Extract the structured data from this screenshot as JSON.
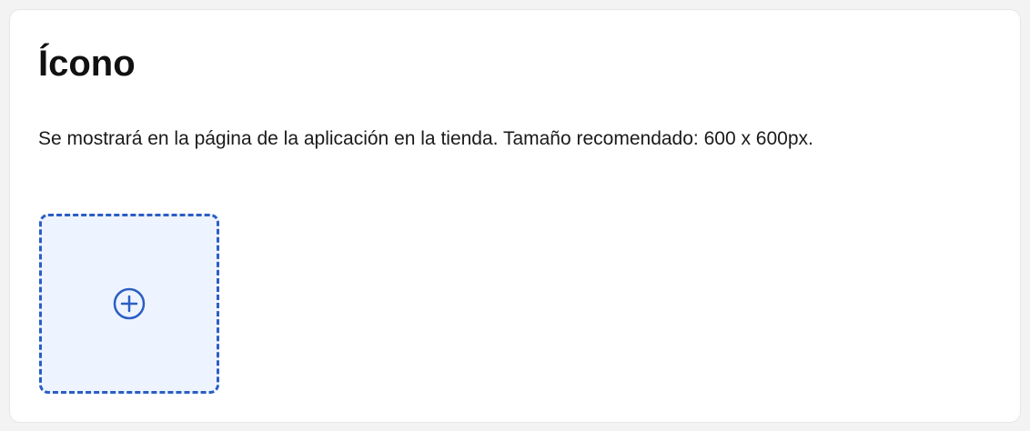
{
  "section": {
    "title": "Ícono",
    "description": "Se mostrará en la página de la aplicación en la tienda. Tamaño recomendado: 600 x 600px."
  },
  "upload": {
    "icon": "plus-circle-icon",
    "accent_color": "#2a5ec4",
    "background_color": "#eef4ff"
  }
}
